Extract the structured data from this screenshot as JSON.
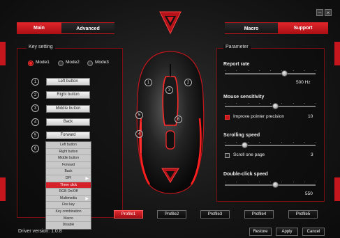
{
  "window": {
    "minimize_icon": "minimize-icon",
    "close_icon": "close-icon"
  },
  "tabs": {
    "main": "Main",
    "advanced": "Advanced",
    "macro": "Macro",
    "support": "Support"
  },
  "key_setting": {
    "title": "Key setting",
    "modes": [
      "Mode1",
      "Mode2",
      "Mode3"
    ],
    "numbers": [
      "1",
      "2",
      "3",
      "4",
      "5",
      "6"
    ],
    "buttons": [
      "Left button",
      "Right button",
      "Middle button",
      "Back",
      "Forward"
    ]
  },
  "dropdown": {
    "items": [
      "Left button",
      "Right button",
      "Middle button",
      "Forward",
      "Back",
      "DPI",
      "Three click",
      "RGB On/Off",
      "Multimedia",
      "Fire key",
      "Key combination",
      "Macro",
      "Disable"
    ],
    "highlighted": "Three click"
  },
  "mouse_labels": [
    "1",
    "2",
    "3",
    "4",
    "5",
    "6"
  ],
  "parameter": {
    "title": "Parameter",
    "report_rate": {
      "label": "Report rate",
      "value": "500 Hz",
      "level": 0.66
    },
    "sensitivity": {
      "label": "Mouse sensitivity",
      "level": 0.56,
      "precision_label": "Improve pointer precision",
      "precision_checked": true,
      "value": "10"
    },
    "scrolling": {
      "label": "Scrolling speed",
      "level": 0.22,
      "scroll_page_label": "Scroll one page",
      "scroll_page_checked": false,
      "value": "3"
    },
    "double_click": {
      "label": "Double-click speed",
      "level": 0.56,
      "value": "550"
    }
  },
  "profiles": [
    "Profile1",
    "Profile2",
    "Profile3",
    "Profile4",
    "Profile5"
  ],
  "footer": {
    "version": "Driver version: 1.0.8",
    "restore": "Restore",
    "apply": "Apply",
    "cancel": "Cancel"
  },
  "colors": {
    "accent": "#c4161c"
  }
}
